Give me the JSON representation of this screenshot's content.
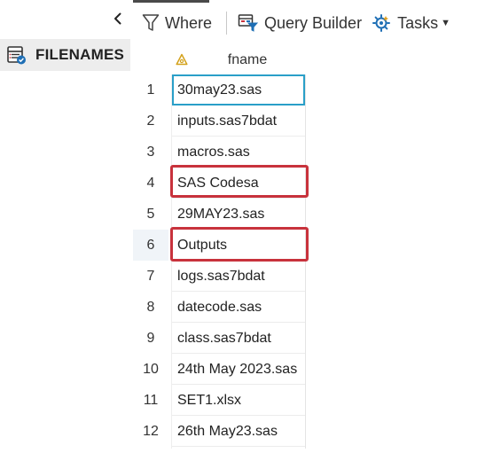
{
  "table": {
    "name": "FILENAMES"
  },
  "toolbar": {
    "where_label": "Where",
    "query_builder_label": "Query Builder",
    "tasks_label": "Tasks"
  },
  "grid": {
    "column_header": "fname",
    "rows": [
      {
        "num": "1",
        "value": "30may23.sas"
      },
      {
        "num": "2",
        "value": "inputs.sas7bdat"
      },
      {
        "num": "3",
        "value": "macros.sas"
      },
      {
        "num": "4",
        "value": "SAS Codesa"
      },
      {
        "num": "5",
        "value": "29MAY23.sas"
      },
      {
        "num": "6",
        "value": "Outputs"
      },
      {
        "num": "7",
        "value": "logs.sas7bdat"
      },
      {
        "num": "8",
        "value": "datecode.sas"
      },
      {
        "num": "9",
        "value": "class.sas7bdat"
      },
      {
        "num": "10",
        "value": "24th May 2023.sas"
      },
      {
        "num": "11",
        "value": "SET1.xlsx"
      },
      {
        "num": "12",
        "value": "26th May23.sas"
      }
    ]
  },
  "colors": {
    "selection_border": "#2a9fc8",
    "annotation_red": "#c8323c"
  }
}
